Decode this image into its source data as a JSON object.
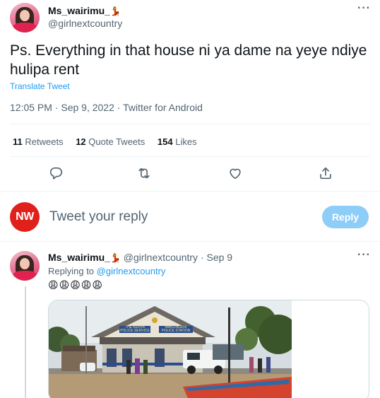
{
  "main_tweet": {
    "display_name": "Ms_wairimu_",
    "name_emoji": "💃",
    "handle": "@girlnextcountry",
    "text": "Ps. Everything in that house ni ya dame na yeye ndiye hulipa rent",
    "translate_label": "Translate Tweet",
    "timestamp": "12:05 PM · Sep 9, 2022 · Twitter for Android",
    "more_icon": "more-icon"
  },
  "stats": {
    "retweets_count": "11",
    "retweets_label": "Retweets",
    "quotes_count": "12",
    "quotes_label": "Quote Tweets",
    "likes_count": "154",
    "likes_label": "Likes"
  },
  "actions": [
    "reply-icon",
    "retweet-icon",
    "like-icon",
    "share-icon"
  ],
  "composer": {
    "avatar_initials": "NW",
    "placeholder": "Tweet your reply",
    "reply_button": "Reply"
  },
  "reply_tweet": {
    "display_name": "Ms_wairimu_",
    "name_emoji": "💃",
    "handle_date": "@girlnextcountry · Sep 9",
    "replying_prefix": "Replying to",
    "replying_handle": "@girlnextcountry",
    "emojis": "😩😩😩😩😩",
    "photo_sign_left": "THE KENYA POLICE SERVICE",
    "photo_sign_right": "MAKONGENI POLICE STATION"
  },
  "colors": {
    "accent": "#1d9bf0",
    "reply_button_disabled": "#8ecdf8",
    "nw_red": "#e0201b",
    "divider": "#eff3f4"
  }
}
